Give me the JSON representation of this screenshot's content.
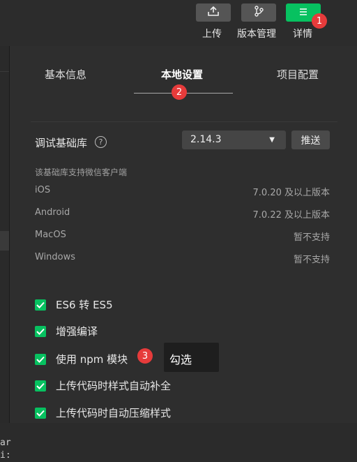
{
  "toolbar": {
    "upload_label": "上传",
    "version_label": "版本管理",
    "details_label": "详情",
    "upload_icon": "upload-icon",
    "version_icon": "branch-icon",
    "details_icon": "menu-icon",
    "accent": "#07c160"
  },
  "tabs": [
    "基本信息",
    "本地设置",
    "项目配置"
  ],
  "active_tab": "本地设置",
  "badges": [
    "1",
    "2",
    "3"
  ],
  "sdk": {
    "label": "调试基础库",
    "version": "2.14.3",
    "push_label": "推送",
    "hint": "该基础库支持微信客户端",
    "platforms": [
      {
        "name": "iOS",
        "support": "7.0.20 及以上版本"
      },
      {
        "name": "Android",
        "support": "7.0.22 及以上版本"
      },
      {
        "name": "MacOS",
        "support": "暂不支持"
      },
      {
        "name": "Windows",
        "support": "暂不支持"
      }
    ]
  },
  "options": [
    {
      "label": "ES6 转 ES5",
      "checked": true
    },
    {
      "label": "增强编译",
      "checked": true
    },
    {
      "label": "使用 npm 模块",
      "checked": true
    },
    {
      "label": "上传代码时样式自动补全",
      "checked": true
    },
    {
      "label": "上传代码时自动压缩样式",
      "checked": true
    }
  ],
  "tooltip": "勾选",
  "left_fragment": [
    "ar",
    "i:"
  ]
}
